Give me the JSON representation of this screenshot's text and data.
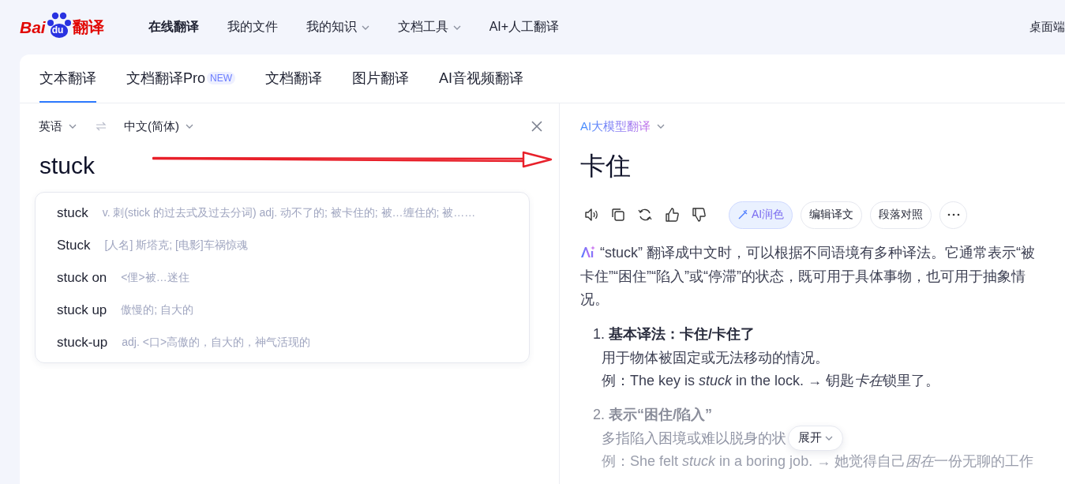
{
  "header": {
    "logo": {
      "latin": "Bai",
      "mark": "du",
      "chinese": "翻译"
    },
    "nav": [
      {
        "label": "在线翻译",
        "selected": true,
        "dropdown": false
      },
      {
        "label": "我的文件",
        "selected": false,
        "dropdown": false
      },
      {
        "label": "我的知识",
        "selected": false,
        "dropdown": true
      },
      {
        "label": "文档工具",
        "selected": false,
        "dropdown": true
      },
      {
        "label": "AI+人工翻译",
        "selected": false,
        "dropdown": false
      }
    ],
    "desktop_link": "桌面端"
  },
  "tabs": [
    {
      "label": "文本翻译",
      "selected": true
    },
    {
      "label": "文档翻译Pro",
      "badge": "NEW",
      "selected": false
    },
    {
      "label": "文档翻译",
      "selected": false
    },
    {
      "label": "图片翻译",
      "selected": false
    },
    {
      "label": "AI音视频翻译",
      "selected": false
    }
  ],
  "source": {
    "language": "英语",
    "target_language": "中文(简体)",
    "value": "stuck",
    "suggestions": [
      {
        "word": "stuck",
        "definition": "v. 刺(stick 的过去式及过去分词) adj. 动不了的; 被卡住的; 被…缠住的; 被……"
      },
      {
        "word": "Stuck",
        "definition": "[人名] 斯塔克; [电影]车祸惊魂"
      },
      {
        "word": "stuck on",
        "definition": "<俚>被…迷住"
      },
      {
        "word": "stuck up",
        "definition": "傲慢的; 自大的"
      },
      {
        "word": "stuck-up",
        "definition": "adj. <口>高傲的，自大的，神气活现的"
      }
    ]
  },
  "result": {
    "engine": "AI大模型翻译",
    "translation": "卡住",
    "buttons": [
      {
        "kind": "ai",
        "label": "AI润色"
      },
      {
        "kind": "plain",
        "label": "编辑译文"
      },
      {
        "kind": "plain",
        "label": "段落对照"
      },
      {
        "kind": "more"
      }
    ],
    "summary": "“stuck” 翻译成中文时，可以根据不同语境有多种译法。它通常表示“被卡住”“困住”“陷入”或“停滞”的状态，既可用于具体事物，也可用于抽象情况。",
    "senses": [
      {
        "number": "1.",
        "title": "基本译法：卡住/卡住了",
        "faded": false,
        "lines": [
          [
            {
              "text": "用于物体被固定或无法移动的情况。",
              "italic": false
            }
          ],
          [
            {
              "text": "例：The key is ",
              "italic": false
            },
            {
              "text": "stuck",
              "italic": true
            },
            {
              "text": " in the lock. → 钥匙",
              "italic": false
            },
            {
              "text": "卡在",
              "italic": true
            },
            {
              "text": "锁里了。",
              "italic": false
            }
          ]
        ]
      },
      {
        "number": "2.",
        "title": "表示“困住/陷入”",
        "faded": true,
        "lines": [
          [
            {
              "text": "多指陷入困境或难以脱身的状",
              "italic": false
            }
          ],
          [
            {
              "text": "例：She felt ",
              "italic": false
            },
            {
              "text": "stuck",
              "italic": true
            },
            {
              "text": " in a boring job. → 她觉得自己",
              "italic": false
            },
            {
              "text": "困在",
              "italic": true
            },
            {
              "text": "一份无聊的工作",
              "italic": false
            }
          ]
        ]
      }
    ],
    "expand_button": "展开"
  }
}
